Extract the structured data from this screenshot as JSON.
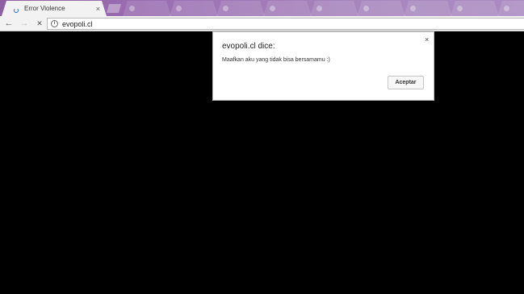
{
  "browser": {
    "active_tab": {
      "title": "Error Violence",
      "close": "×"
    },
    "background_tabs": [
      "Tab",
      "Tab",
      "Tab",
      "Tab",
      "Tab",
      "Tab",
      "Tab",
      "Tab"
    ],
    "toolbar": {
      "back": "←",
      "forward": "→",
      "stop": "✕",
      "info": "i",
      "url": "evopoli.cl"
    }
  },
  "dialog": {
    "title": "evopoli.cl dice:",
    "message": "Maafkan aku yang tidak bisa bersamamu :)",
    "button_label": "Aceptar",
    "close": "×"
  },
  "colors": {
    "tabstrip": "#9e74b5",
    "page_background": "#000000",
    "loading_indicator": "#2a6ad8"
  }
}
